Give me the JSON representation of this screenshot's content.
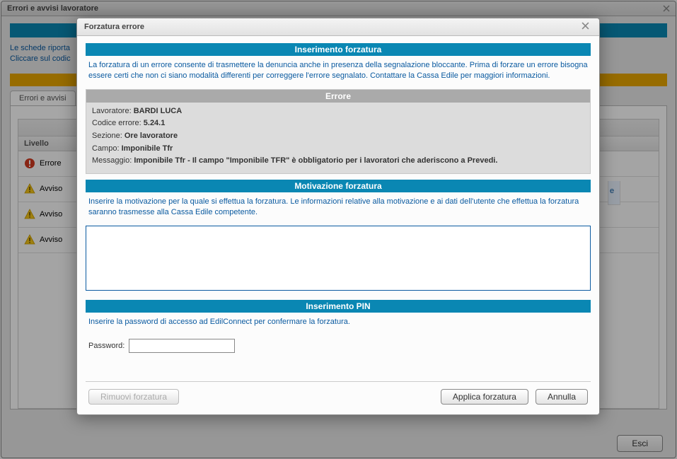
{
  "bg": {
    "title": "Errori e avvisi lavoratore",
    "note1": "Le schede riporta",
    "note2": "Cliccare sul codic",
    "tab": "Errori e avvisi",
    "th_livello": "Livello",
    "rows": [
      {
        "level": "Errore",
        "kind": "error"
      },
      {
        "level": "Avviso",
        "kind": "warn"
      },
      {
        "level": "Avviso",
        "kind": "warn"
      },
      {
        "level": "Avviso",
        "kind": "warn"
      }
    ],
    "stray_cell": "e",
    "esci": "Esci"
  },
  "modal": {
    "title": "Forzatura errore",
    "section_inserimento": "Inserimento forzatura",
    "intro": "La forzatura di un errore consente di trasmettere la denuncia anche in presenza della segnalazione bloccante. Prima di forzare un errore bisogna essere certi che non ci siano modalità differenti per correggere l'errore segnalato. Contattare la Cassa Edile per maggiori informazioni.",
    "errore": {
      "head": "Errore",
      "lavoratore_label": "Lavoratore:",
      "lavoratore_value": "BARDI LUCA",
      "codice_label": "Codice errore:",
      "codice_value": "5.24.1",
      "sezione_label": "Sezione:",
      "sezione_value": "Ore lavoratore",
      "campo_label": "Campo:",
      "campo_value": "Imponibile Tfr",
      "messaggio_label": "Messaggio:",
      "messaggio_value": "Imponibile Tfr - Il campo \"Imponibile TFR\" è obbligatorio per i lavoratori che aderiscono a Prevedi."
    },
    "section_motivazione": "Motivazione forzatura",
    "motivazione_help": "Inserire la motivazione per la quale si effettua la forzatura. Le informazioni relative alla motivazione e ai dati dell'utente che effettua la forzatura saranno trasmesse alla Cassa Edile competente.",
    "motivazione_value": "",
    "section_pin": "Inserimento PIN",
    "pin_help": "Inserire la password di accesso ad EdilConnect per confermare la forzatura.",
    "password_label": "Password:",
    "password_value": "",
    "btn_rimuovi": "Rimuovi forzatura",
    "btn_applica": "Applica forzatura",
    "btn_annulla": "Annulla"
  }
}
